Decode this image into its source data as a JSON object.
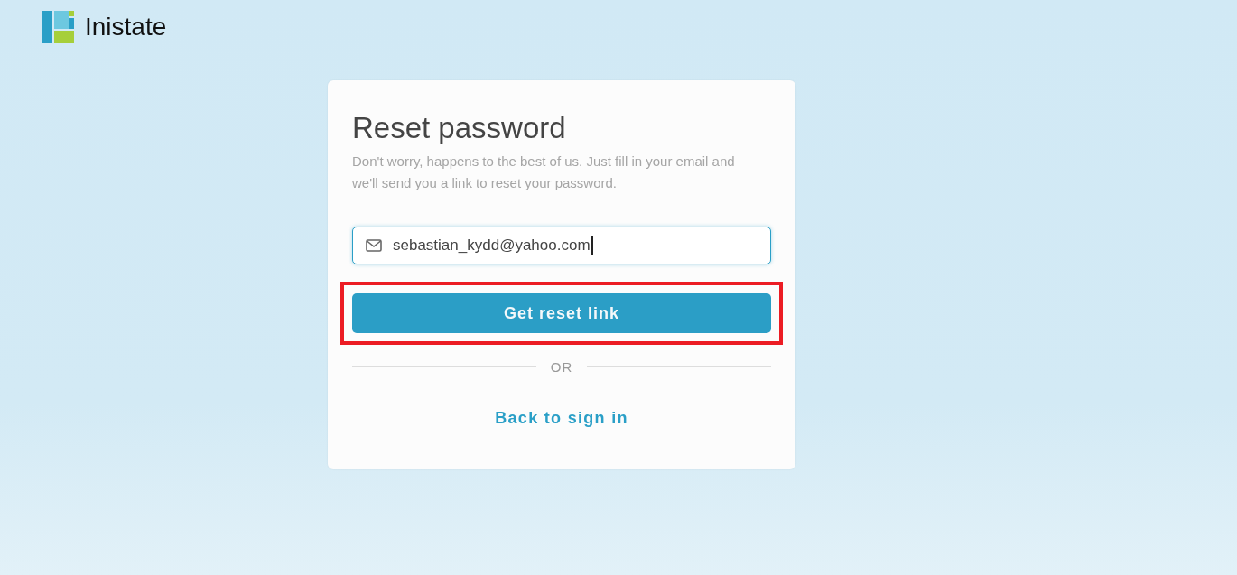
{
  "brand": {
    "name": "Inistate"
  },
  "card": {
    "title": "Reset password",
    "subtitle": "Don't worry, happens to the best of us. Just fill in your email and we'll send you a link to reset your password.",
    "email": {
      "value": "sebastian_kydd@yahoo.com",
      "focused": true
    },
    "submit": {
      "label": "Get reset link",
      "highlighted": true
    },
    "divider": "OR",
    "back_link": "Back to sign in"
  }
}
